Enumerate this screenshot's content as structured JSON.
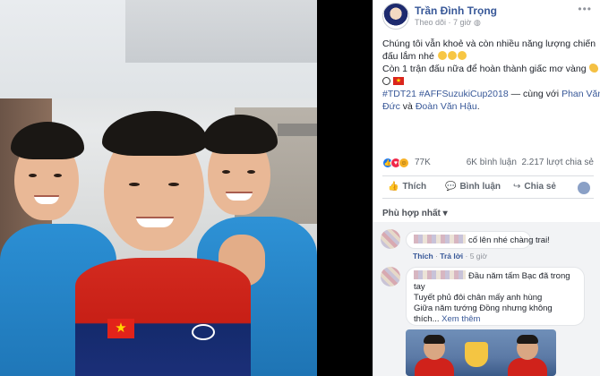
{
  "post": {
    "author": "Trần Đình Trọng",
    "follow": "Theo dõi",
    "time": "7 giờ",
    "body": {
      "line1": "Chúng tôi vẫn khoẻ và còn nhiều năng lượng chiến",
      "line2": "đấu lắm nhé",
      "line3": "Còn 1 trận đấu nữa để hoàn thành giấc mơ vàng",
      "hashtags": "#TDT21 #AFFSuzukiCup2018",
      "with_text": " — cùng với ",
      "friend1": "Phan Văn",
      "friend1b": "Đức",
      "and": " và ",
      "friend2": "Đoàn Văn Hậu",
      "end": "."
    },
    "reactions": {
      "count": "77K",
      "comments": "6K bình luận",
      "shares": "2.217 lượt chia sẻ"
    },
    "actions": {
      "like": "Thích",
      "comment": "Bình luận",
      "share": "Chia sẻ"
    },
    "sort_label": "Phù hợp nhất",
    "sort_caret": "▾"
  },
  "comments": [
    {
      "text": "cố lên nhé chàng trai!",
      "like": "Thích",
      "reply": "Trả lời",
      "time": "5 giờ"
    },
    {
      "line1": "Đầu năm tấm Bạc đã trong",
      "line2": "tay",
      "line3": "Tuyết phủ đôi chân mấy anh hùng",
      "line4": "Giữa năm tướng Đồng nhưng không",
      "line5": "thích...",
      "see_more": "Xem thêm"
    }
  ],
  "icons": {
    "like": "👍",
    "comment": "💬",
    "share": "↪",
    "more": "•••",
    "like_glyph": "👍",
    "love_glyph": "♥",
    "haha_glyph": "☺"
  },
  "colors": {
    "link": "#385898",
    "like_blue": "#1877f2",
    "love_red": "#f02849"
  }
}
